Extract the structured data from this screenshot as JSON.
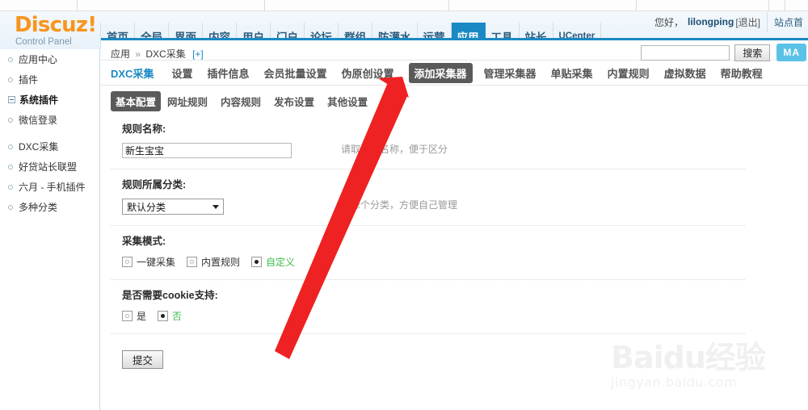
{
  "brand": {
    "logo_main": "Discuz!",
    "logo_sub": "Control Panel",
    "logo_color": "#f7951d",
    "accent_color": "#1b89c4"
  },
  "topnav": {
    "items": [
      {
        "label": "首页",
        "active": false
      },
      {
        "label": "全局",
        "active": false
      },
      {
        "label": "界面",
        "active": false
      },
      {
        "label": "内容",
        "active": false
      },
      {
        "label": "用户",
        "active": false
      },
      {
        "label": "门户",
        "active": false
      },
      {
        "label": "论坛",
        "active": false
      },
      {
        "label": "群组",
        "active": false
      },
      {
        "label": "防灌水",
        "active": false
      },
      {
        "label": "运营",
        "active": false
      },
      {
        "label": "应用",
        "active": true
      },
      {
        "label": "工具",
        "active": false
      },
      {
        "label": "站长",
        "active": false
      },
      {
        "label": "UCenter",
        "active": false
      }
    ]
  },
  "user": {
    "greeting": "您好，",
    "username": "lilongping",
    "logout": "[退出]",
    "site_link": "站点首"
  },
  "sidebar": {
    "items": [
      {
        "label": "应用中心",
        "type": "bullet"
      },
      {
        "label": "插件",
        "type": "bullet"
      },
      {
        "label": "系统插件",
        "type": "group"
      },
      {
        "label": "微信登录",
        "type": "bullet"
      },
      {
        "label": "DXC采集",
        "type": "bullet"
      },
      {
        "label": "好贷站长联盟",
        "type": "bullet"
      },
      {
        "label": "六月 - 手机插件",
        "type": "bullet"
      },
      {
        "label": "多种分类",
        "type": "bullet"
      }
    ]
  },
  "breadcrumb": {
    "root": "应用",
    "separator": "»",
    "current": "DXC采集",
    "plus": "[+]"
  },
  "search": {
    "value": "",
    "placeholder": "",
    "button_label": "搜索",
    "ma_label": "MA"
  },
  "tabs": [
    {
      "label": "DXC采集",
      "style": "first"
    },
    {
      "label": "设置",
      "style": "normal"
    },
    {
      "label": "插件信息",
      "style": "normal"
    },
    {
      "label": "会员批量设置",
      "style": "normal"
    },
    {
      "label": "伪原创设置",
      "style": "normal"
    },
    {
      "label": "添加采集器",
      "style": "active"
    },
    {
      "label": "管理采集器",
      "style": "normal"
    },
    {
      "label": "单贴采集",
      "style": "normal"
    },
    {
      "label": "内置规则",
      "style": "normal"
    },
    {
      "label": "虚拟数据",
      "style": "normal"
    },
    {
      "label": "帮助教程",
      "style": "normal"
    }
  ],
  "subtabs": [
    {
      "label": "基本配置",
      "active": true
    },
    {
      "label": "网址规则",
      "active": false
    },
    {
      "label": "内容规则",
      "active": false
    },
    {
      "label": "发布设置",
      "active": false
    },
    {
      "label": "其他设置",
      "active": false
    }
  ],
  "form": {
    "rule_name": {
      "label": "规则名称:",
      "value": "新生宝宝",
      "hint": "请取个好名称，便于区分"
    },
    "rule_category": {
      "label": "规则所属分类:",
      "value": "默认分类",
      "hint": "选择个分类，方便自己管理"
    },
    "collect_mode": {
      "label": "采集模式:",
      "options": [
        {
          "label": "一键采集",
          "selected": false
        },
        {
          "label": "内置规则",
          "selected": false
        },
        {
          "label": "自定义",
          "selected": true
        }
      ]
    },
    "cookie_support": {
      "label": "是否需要cookie支持:",
      "options": [
        {
          "label": "是",
          "selected": false
        },
        {
          "label": "否",
          "selected": true
        }
      ]
    },
    "submit_label": "提交"
  },
  "watermark": {
    "line1": "Baidu经验",
    "line2": "jingyan.baidu.com"
  },
  "annotation": {
    "arrow_color": "#ee2222",
    "description": "red-arrow pointing to 添加采集器 tab"
  }
}
